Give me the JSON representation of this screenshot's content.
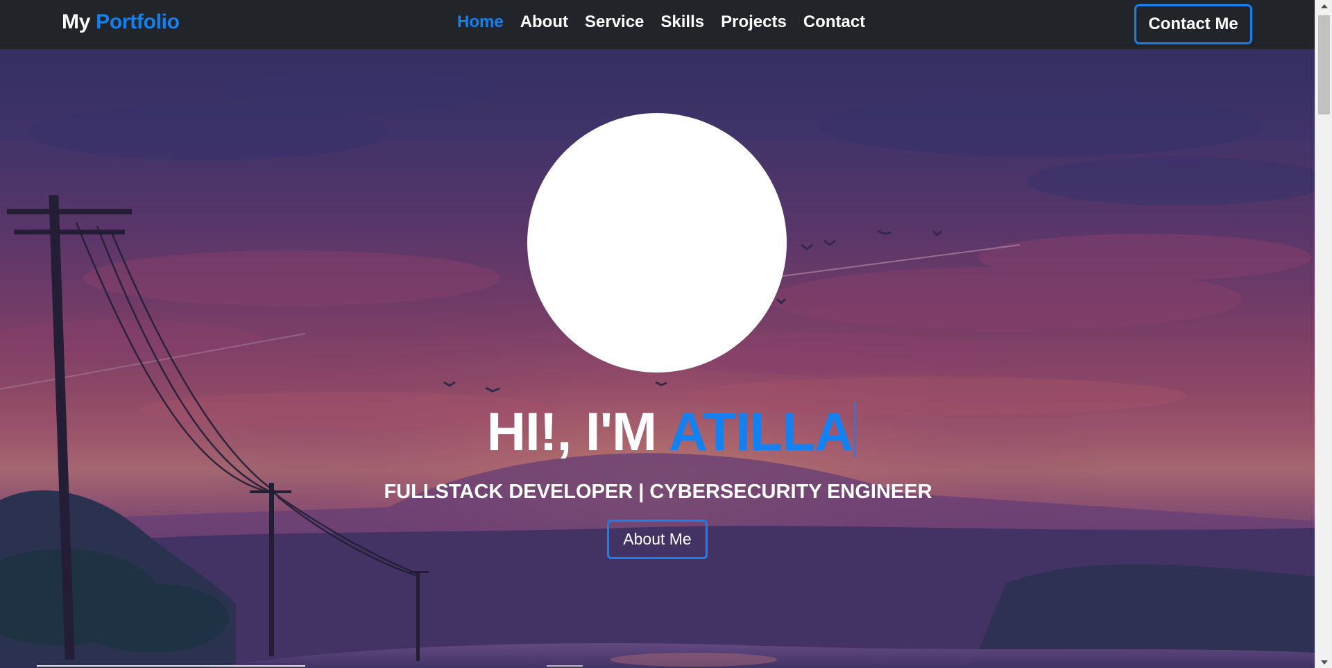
{
  "brand": {
    "prefix": "My",
    "accent": "Portfolio"
  },
  "nav": {
    "links": [
      {
        "label": "Home",
        "active": true
      },
      {
        "label": "About",
        "active": false
      },
      {
        "label": "Service",
        "active": false
      },
      {
        "label": "Skills",
        "active": false
      },
      {
        "label": "Projects",
        "active": false
      },
      {
        "label": "Contact",
        "active": false
      }
    ],
    "cta_label": "Contact Me"
  },
  "hero": {
    "greeting": "HI!, I'M",
    "name": "ATILLA",
    "subtitle": "FULLSTACK DEVELOPER | CYBERSECURITY ENGINEER",
    "button_label": "About Me"
  },
  "colors": {
    "accent": "#1580f0",
    "navbar_bg": "#212529",
    "text": "#ffffff"
  }
}
